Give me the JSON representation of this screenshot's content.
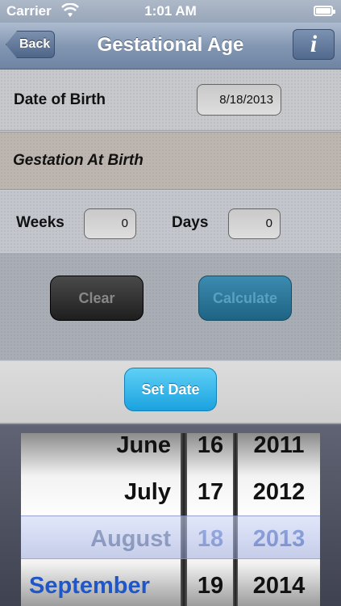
{
  "status": {
    "carrier": "Carrier",
    "time": "1:01 AM"
  },
  "nav": {
    "back_label": "Back",
    "title": "Gestational Age",
    "info_label": "i"
  },
  "dob": {
    "label": "Date of Birth",
    "value": "8/18/2013"
  },
  "gestation": {
    "title": "Gestation At Birth",
    "weeks_label": "Weeks",
    "weeks_value": "0",
    "days_label": "Days",
    "days_value": "0"
  },
  "buttons": {
    "clear": "Clear",
    "calculate": "Calculate",
    "set_date": "Set Date"
  },
  "picker": {
    "months": [
      "June",
      "July",
      "August",
      "September"
    ],
    "days": [
      "16",
      "17",
      "18",
      "19"
    ],
    "years": [
      "2011",
      "2012",
      "2013",
      "2014"
    ],
    "selected": {
      "month": "August",
      "day": "18",
      "year": "2013"
    }
  },
  "colors": {
    "accent": "#1aa2e0",
    "nav": "#6e84a3",
    "picker_highlight": "#1f57c8"
  }
}
